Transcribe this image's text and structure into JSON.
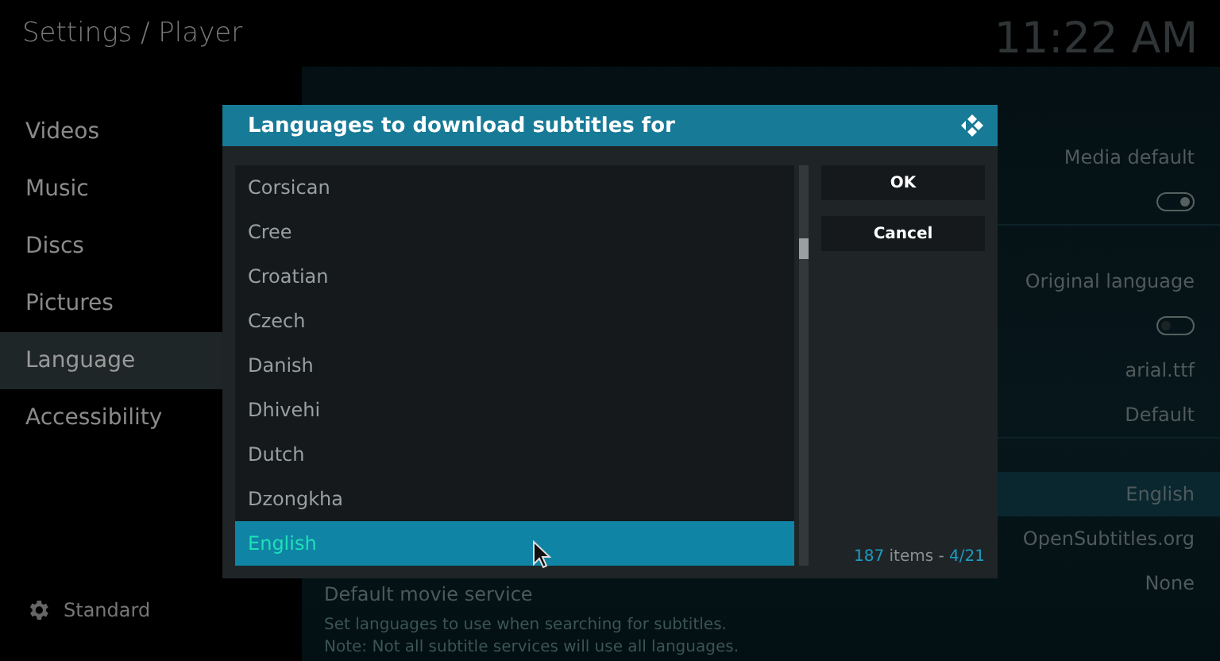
{
  "header": {
    "title": "Settings / Player",
    "clock": "11:22 AM"
  },
  "sidebar": {
    "items": [
      {
        "label": "Videos",
        "selected": false
      },
      {
        "label": "Music",
        "selected": false
      },
      {
        "label": "Discs",
        "selected": false
      },
      {
        "label": "Pictures",
        "selected": false
      },
      {
        "label": "Language",
        "selected": true
      },
      {
        "label": "Accessibility",
        "selected": false
      }
    ],
    "level_button": {
      "label": "Standard"
    }
  },
  "settings": {
    "sections": [
      [
        {
          "kind": "value",
          "value": "Media default",
          "selected": false
        },
        {
          "kind": "toggle",
          "on": true,
          "selected": false
        }
      ],
      [
        {
          "kind": "value",
          "value": "Original language",
          "selected": false
        },
        {
          "kind": "toggle",
          "on": false,
          "selected": false
        },
        {
          "kind": "value",
          "value": "arial.ttf",
          "selected": false
        },
        {
          "kind": "value",
          "value": "Default",
          "selected": false
        }
      ],
      [
        {
          "kind": "value",
          "value": "English",
          "selected": true
        },
        {
          "kind": "value",
          "value": "OpenSubtitles.org",
          "selected": false
        },
        {
          "kind": "value",
          "label": "Default movie service",
          "value": "None",
          "selected": false
        }
      ]
    ],
    "description": [
      "Set languages to use when searching for subtitles.",
      "Note: Not all subtitle services will use all languages."
    ]
  },
  "dialog": {
    "title": "Languages to download subtitles for",
    "items": [
      {
        "label": "Corsican",
        "selected": false
      },
      {
        "label": "Cree",
        "selected": false
      },
      {
        "label": "Croatian",
        "selected": false
      },
      {
        "label": "Czech",
        "selected": false
      },
      {
        "label": "Danish",
        "selected": false
      },
      {
        "label": "Dhivehi",
        "selected": false
      },
      {
        "label": "Dutch",
        "selected": false
      },
      {
        "label": "Dzongkha",
        "selected": false
      },
      {
        "label": "English",
        "selected": true
      }
    ],
    "buttons": [
      "OK",
      "Cancel"
    ],
    "footer": {
      "count": "187",
      "label": "items -",
      "position": "4/21"
    }
  }
}
